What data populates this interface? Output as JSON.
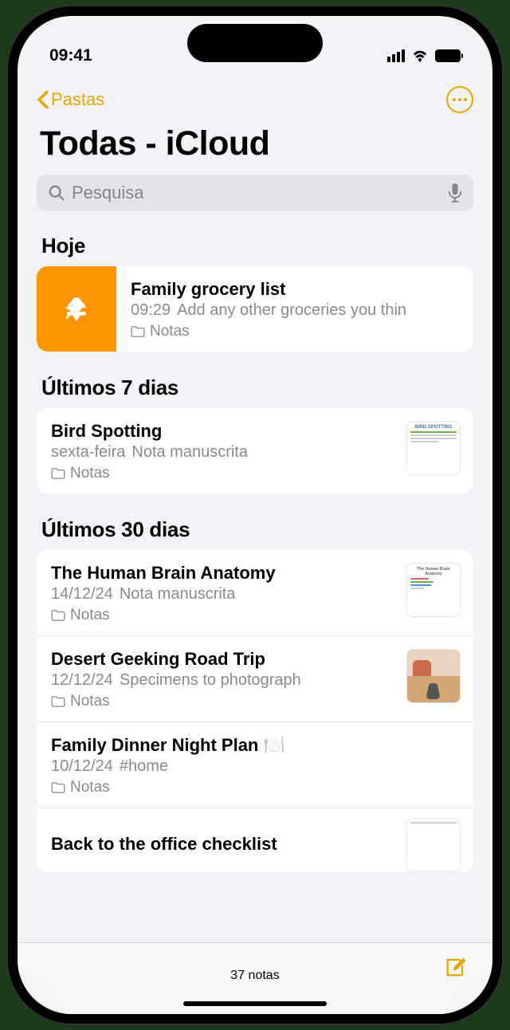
{
  "status": {
    "time": "09:41"
  },
  "nav": {
    "back_label": "Pastas"
  },
  "title": "Todas - iCloud",
  "search": {
    "placeholder": "Pesquisa"
  },
  "sections": {
    "today": {
      "header": "Hoje",
      "notes": [
        {
          "title": "Family grocery list",
          "date": "09:29",
          "preview": "Add any other groceries you thin",
          "folder": "Notas",
          "pinned": true
        }
      ]
    },
    "last7": {
      "header": "Últimos 7 dias",
      "notes": [
        {
          "title": "Bird Spotting",
          "date": "sexta-feira",
          "preview": "Nota manuscrita",
          "folder": "Notas",
          "thumb_label": "BIRD SPOTTING",
          "thumb_color": "#3a7ca5"
        }
      ]
    },
    "last30": {
      "header": "Últimos 30 dias",
      "notes": [
        {
          "title": "The Human Brain Anatomy",
          "date": "14/12/24",
          "preview": "Nota manuscrita",
          "folder": "Notas",
          "thumb_label": "The Human Brain Anatomy"
        },
        {
          "title": "Desert Geeking Road Trip",
          "date": "12/12/24",
          "preview": "Specimens to photograph",
          "folder": "Notas",
          "thumb_type": "desert"
        },
        {
          "title": "Family Dinner Night Plan 🍽️",
          "date": "10/12/24",
          "preview": "#home",
          "folder": "Notas"
        },
        {
          "title": "Back to the office checklist",
          "date": "",
          "preview": "",
          "folder": ""
        }
      ]
    }
  },
  "bottom": {
    "count": "37 notas"
  }
}
